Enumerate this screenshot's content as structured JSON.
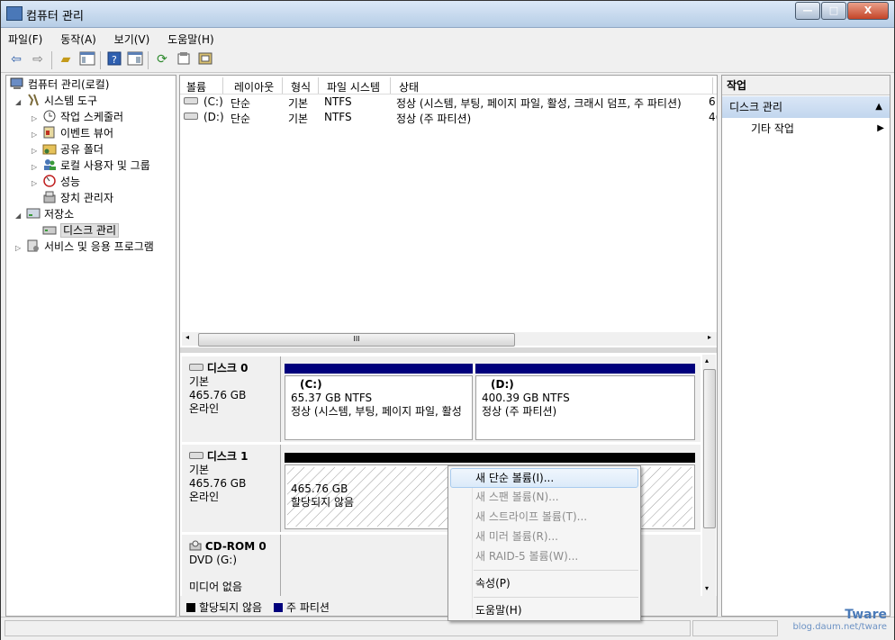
{
  "window": {
    "title": "컴퓨터 관리",
    "minimize": "—",
    "maximize": "□",
    "close": "X"
  },
  "menu": [
    "파일(F)",
    "동작(A)",
    "보기(V)",
    "도움말(H)"
  ],
  "toolbar_icons": [
    "back-icon",
    "forward-icon",
    "up-folder-icon",
    "show-hide-tree-icon",
    "help-icon",
    "show-hide-action-icon",
    "refresh-icon",
    "properties-icon",
    "connect-icon"
  ],
  "tree": {
    "root": "컴퓨터 관리(로컬)",
    "system_tools": "시스템 도구",
    "task_scheduler": "작업 스케줄러",
    "event_viewer": "이벤트 뷰어",
    "shared_folders": "공유 폴더",
    "local_users": "로컬 사용자 및 그룹",
    "performance": "성능",
    "device_manager": "장치 관리자",
    "storage": "저장소",
    "disk_management": "디스크 관리",
    "services": "서비스 및 응용 프로그램"
  },
  "volume_list": {
    "headers": [
      "볼륨",
      "레이아웃",
      "형식",
      "파일 시스템",
      "상태"
    ],
    "rows": [
      {
        "volume": "(C:)",
        "layout": "단순",
        "type": "기본",
        "fs": "NTFS",
        "status": "정상 (시스템, 부팅, 페이지 파일, 활성, 크래시 덤프, 주 파티션)",
        "trunc": "6!"
      },
      {
        "volume": "(D:)",
        "layout": "단순",
        "type": "기본",
        "fs": "NTFS",
        "status": "정상 (주 파티션)",
        "trunc": "4("
      }
    ],
    "scroll_thumb": "III"
  },
  "disks": [
    {
      "name": "디스크 0",
      "type": "기본",
      "size": "465.76 GB",
      "state": "온라인",
      "partitions": [
        {
          "label": "(C:)",
          "size": "65.37 GB NTFS",
          "status": "정상 (시스템, 부팅, 페이지 파일, 활성"
        },
        {
          "label": "(D:)",
          "size": "400.39 GB NTFS",
          "status": "정상 (주 파티션)"
        }
      ]
    },
    {
      "name": "디스크 1",
      "type": "기본",
      "size": "465.76 GB",
      "state": "온라인",
      "partitions": [
        {
          "size": "465.76 GB",
          "status": "할당되지 않음"
        }
      ]
    },
    {
      "name": "CD-ROM 0",
      "type": "DVD (G:)",
      "state": "미디어 없음"
    }
  ],
  "legend": [
    {
      "label": "할당되지 않음",
      "color": "#000000"
    },
    {
      "label": "주 파티션",
      "color": "#00007c"
    }
  ],
  "actions": {
    "header": "작업",
    "section": "디스크 관리",
    "item": "기타 작업"
  },
  "context_menu": {
    "new_simple": "새 단순 볼륨(I)...",
    "new_spanned": "새 스팬 볼륨(N)...",
    "new_striped": "새 스트라이프 볼륨(T)...",
    "new_mirrored": "새 미러 볼륨(R)...",
    "new_raid5": "새 RAID-5 볼륨(W)...",
    "properties": "속성(P)",
    "help": "도움말(H)"
  },
  "watermark": {
    "brand": "Tware",
    "url": "blog.daum.net/tware"
  },
  "colors": {
    "primary_partition": "#00007c",
    "unallocated": "#000000",
    "menu_highlight": "#dbeaf9"
  }
}
